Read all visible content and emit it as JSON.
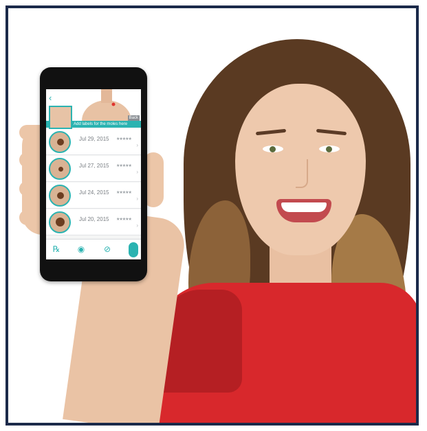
{
  "app": {
    "back_button": "‹",
    "back_label": "Back",
    "label_prompt": "Add labels for the moles here",
    "entries": [
      {
        "date": "Jul 29, 2015",
        "rating": "★★★★★"
      },
      {
        "date": "Jul 27, 2015",
        "rating": "★★★★★"
      },
      {
        "date": "Jul 24, 2015",
        "rating": "★★★★★"
      },
      {
        "date": "Jul 20, 2015",
        "rating": "★★★★★"
      }
    ],
    "tabs": [
      "dermatology-icon",
      "profile-icon",
      "bandage-icon"
    ],
    "accent_color": "#2bb3b1"
  },
  "frame_color": "#1b2a4a",
  "shirt_color": "#d8282c"
}
